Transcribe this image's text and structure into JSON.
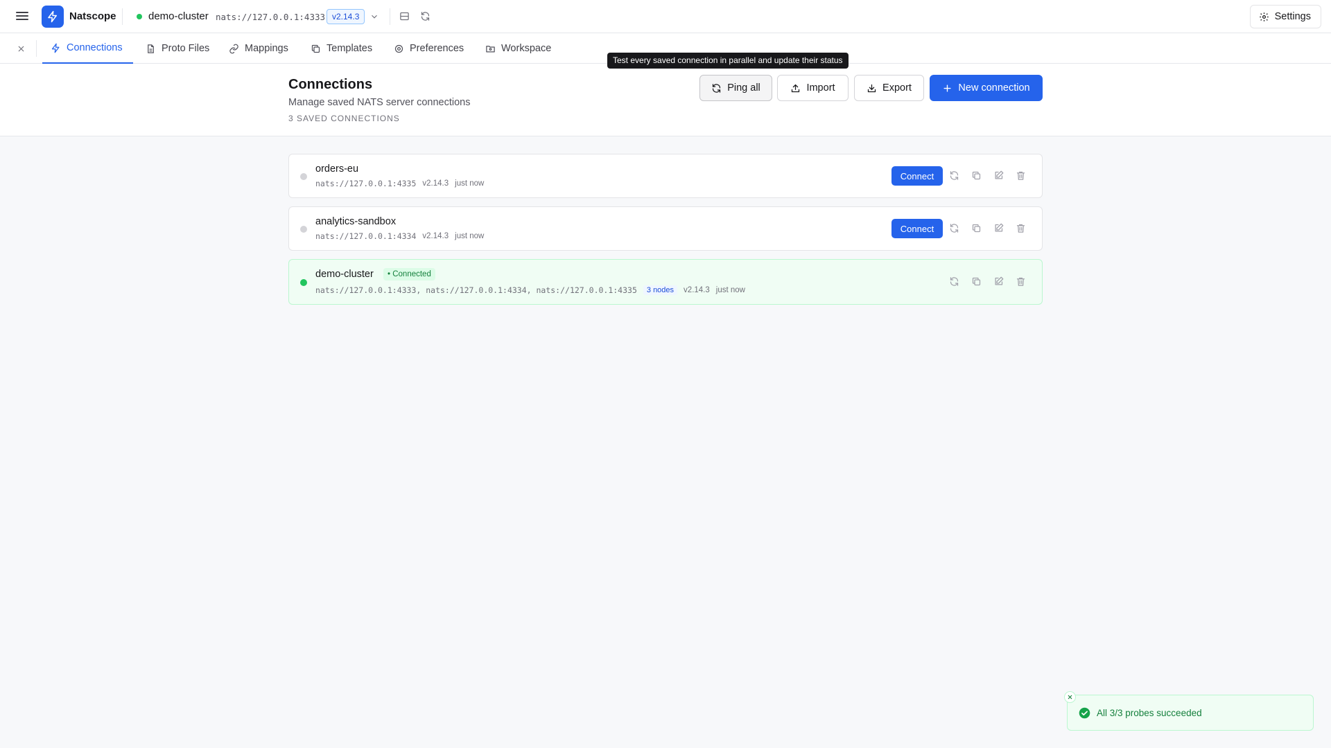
{
  "topbar": {
    "app_title": "Natscope",
    "active_connection": {
      "name": "demo-cluster",
      "url": "nats://127.0.0.1:4333",
      "version": "v2.14.3",
      "status_color": "#22c55e"
    },
    "settings_label": "Settings"
  },
  "tabs": [
    {
      "label": "Connections",
      "icon": "lightning-icon",
      "active": true
    },
    {
      "label": "Proto Files",
      "icon": "file-icon"
    },
    {
      "label": "Mappings",
      "icon": "link-icon"
    },
    {
      "label": "Templates",
      "icon": "copy-icon"
    },
    {
      "label": "Preferences",
      "icon": "gear-icon"
    },
    {
      "label": "Workspace",
      "icon": "folder-icon"
    }
  ],
  "tooltip": "Test every saved connection in parallel and update their status",
  "header": {
    "title": "Connections",
    "subtitle": "Manage saved NATS server connections",
    "count_label": "3 SAVED CONNECTIONS",
    "ping_all_label": "Ping all",
    "import_label": "Import",
    "export_label": "Export",
    "new_connection_label": "New connection"
  },
  "connections": [
    {
      "name": "orders-eu",
      "url": "nats://127.0.0.1:4335",
      "version": "v2.14.3",
      "last_seen": "just now",
      "connect_label": "Connect",
      "connected": false
    },
    {
      "name": "analytics-sandbox",
      "url": "nats://127.0.0.1:4334",
      "version": "v2.14.3",
      "last_seen": "just now",
      "connect_label": "Connect",
      "connected": false
    },
    {
      "name": "demo-cluster",
      "status_badge": "• Connected",
      "url": "nats://127.0.0.1:4333, nats://127.0.0.1:4334, nats://127.0.0.1:4335",
      "nodes": "3 nodes",
      "version": "v2.14.3",
      "last_seen": "just now",
      "connected": true
    }
  ],
  "toast": {
    "message": "All 3/3 probes succeeded",
    "color": "#16a34a"
  },
  "colors": {
    "accent": "#2563eb",
    "success": "#22c55e"
  }
}
